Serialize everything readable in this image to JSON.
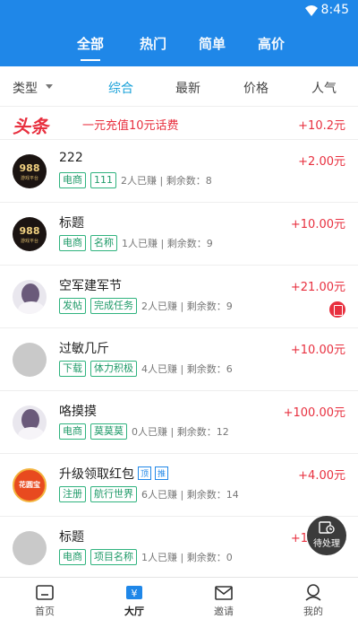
{
  "status": {
    "time": "8:45"
  },
  "top_tabs": [
    "全部",
    "热门",
    "简单",
    "高价"
  ],
  "filters": {
    "type_label": "类型",
    "sort_options": [
      "综合",
      "最新",
      "价格",
      "人气"
    ]
  },
  "headline": {
    "logo": "头条",
    "text": "一元充值10元话费",
    "amount": "+10.2元"
  },
  "tasks": [
    {
      "title": "222",
      "price": "+2.00元",
      "tags": [
        "电商",
        "111"
      ],
      "meta": "2人已赚 | 剩余数：8",
      "avatar": "988",
      "avatar_text": "988",
      "avatar_sub": "游戏平台"
    },
    {
      "title": "标题",
      "price": "+10.00元",
      "tags": [
        "电商",
        "名称"
      ],
      "meta": "1人已赚 | 剩余数：9",
      "avatar": "988",
      "avatar_text": "988",
      "avatar_sub": "游戏平台"
    },
    {
      "title": "空军建军节",
      "price": "+21.00元",
      "tags": [
        "发帖",
        "完成任务"
      ],
      "meta": "2人已赚 | 剩余数：9",
      "avatar": "girl",
      "badge": true
    },
    {
      "title": "过敏几斤",
      "price": "+10.00元",
      "tags": [
        "下载",
        "体力积极"
      ],
      "meta": "4人已赚 | 剩余数：6",
      "avatar": "gray"
    },
    {
      "title": "咯摸摸",
      "price": "+100.00元",
      "tags": [
        "电商",
        "莫莫莫"
      ],
      "meta": "0人已赚 | 剩余数：12",
      "avatar": "girl"
    },
    {
      "title": "升级领取红包",
      "price": "+4.00元",
      "tags": [
        "注册",
        "航行世界"
      ],
      "meta": "6人已赚 | 剩余数：14",
      "avatar": "red",
      "avatar_text": "花圆宝",
      "pins": [
        "顶",
        "推"
      ]
    },
    {
      "title": "标题",
      "price": "+10.00元",
      "tags": [
        "电商",
        "项目名称"
      ],
      "meta": "1人已赚 | 剩余数：0",
      "avatar": "gray"
    }
  ],
  "floating": {
    "label": "待处理"
  },
  "bottom_nav": [
    "首页",
    "大厅",
    "邀请",
    "我的"
  ],
  "colors": {
    "primary": "#1f87e8",
    "accent_red": "#e8303f",
    "tag_green": "#2fb37e"
  }
}
